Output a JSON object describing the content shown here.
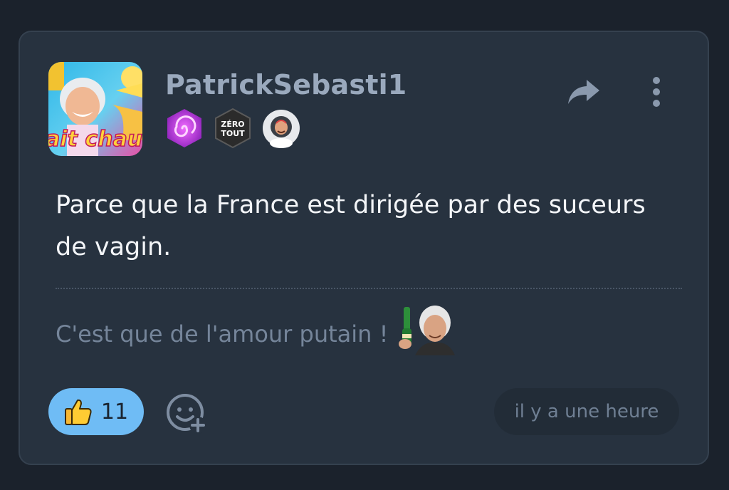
{
  "post": {
    "username": "PatrickSebasti1",
    "avatar_caption": "ait chaud",
    "badges": [
      {
        "icon": "purple-swirl-badge-icon"
      },
      {
        "icon": "zero-tout-badge-icon",
        "line1": "ZÉRO",
        "line2": "TOUT"
      },
      {
        "icon": "astronaut-sticker-badge-icon"
      }
    ],
    "text": "Parce que la France est dirigée par des suceurs de vagin.",
    "signature": "C'est que de l'amour putain !",
    "likes": "11",
    "time": "il y a une heure"
  },
  "colors": {
    "background": "#1b222c",
    "card": "#27323f",
    "username": "#9aa9bd",
    "like_pill": "#6fbcf5",
    "text": "#f3f5f8",
    "muted": "#75859a"
  }
}
